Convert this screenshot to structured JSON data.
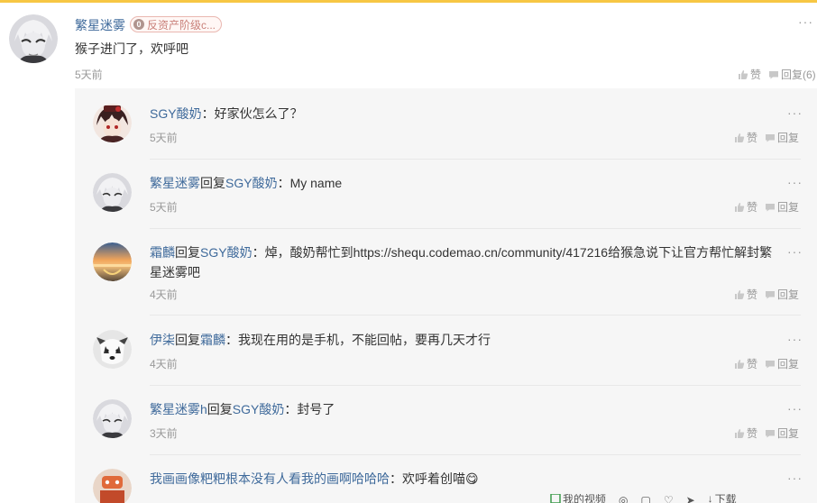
{
  "main": {
    "author": "繁星迷雾",
    "badge_level": "0",
    "badge_text": "反资产阶级c...",
    "text": "猴子进门了，欢呼吧",
    "time": "5天前",
    "like_label": "赞",
    "reply_label": "回复(6)",
    "more": "···"
  },
  "replies": [
    {
      "user": "SGY酸奶",
      "reply_word": "",
      "target": "",
      "text": "：好家伙怎么了？",
      "time": "5天前",
      "like": "赞",
      "reply": "回复",
      "more": "···"
    },
    {
      "user": "繁星迷雾",
      "reply_word": "回复",
      "target": "SGY酸奶",
      "text": "：My name",
      "time": "5天前",
      "like": "赞",
      "reply": "回复",
      "more": "···"
    },
    {
      "user": "霜麟",
      "reply_word": "回复",
      "target": "SGY酸奶",
      "text": "：焯，酸奶帮忙到https://shequ.codemao.cn/community/417216给猴急说下让官方帮忙解封繁星迷雾吧",
      "time": "4天前",
      "like": "赞",
      "reply": "回复",
      "more": "···"
    },
    {
      "user": "伊柒",
      "reply_word": "回复",
      "target": "霜麟",
      "text": "：我现在用的是手机，不能回帖，要再几天才行",
      "time": "4天前",
      "like": "赞",
      "reply": "回复",
      "more": "···"
    },
    {
      "user": "繁星迷雾h",
      "reply_word": "回复",
      "target": "SGY酸奶",
      "text": "：封号了",
      "time": "3天前",
      "like": "赞",
      "reply": "回复",
      "more": "···"
    },
    {
      "user": "我画画像粑粑根本没有人看我的画啊哈哈哈",
      "reply_word": "",
      "target": "",
      "text": "：欢呼着创喵😋",
      "time": "",
      "like": "",
      "reply": "",
      "more": "···"
    }
  ],
  "toolbar": {
    "topic_label": "我的视频",
    "expand_label": "下载"
  },
  "colors": {
    "accent_top": "#f7c744",
    "username": "#3f6a9b",
    "muted": "#999999",
    "reply_bg": "#f6f6f6"
  }
}
